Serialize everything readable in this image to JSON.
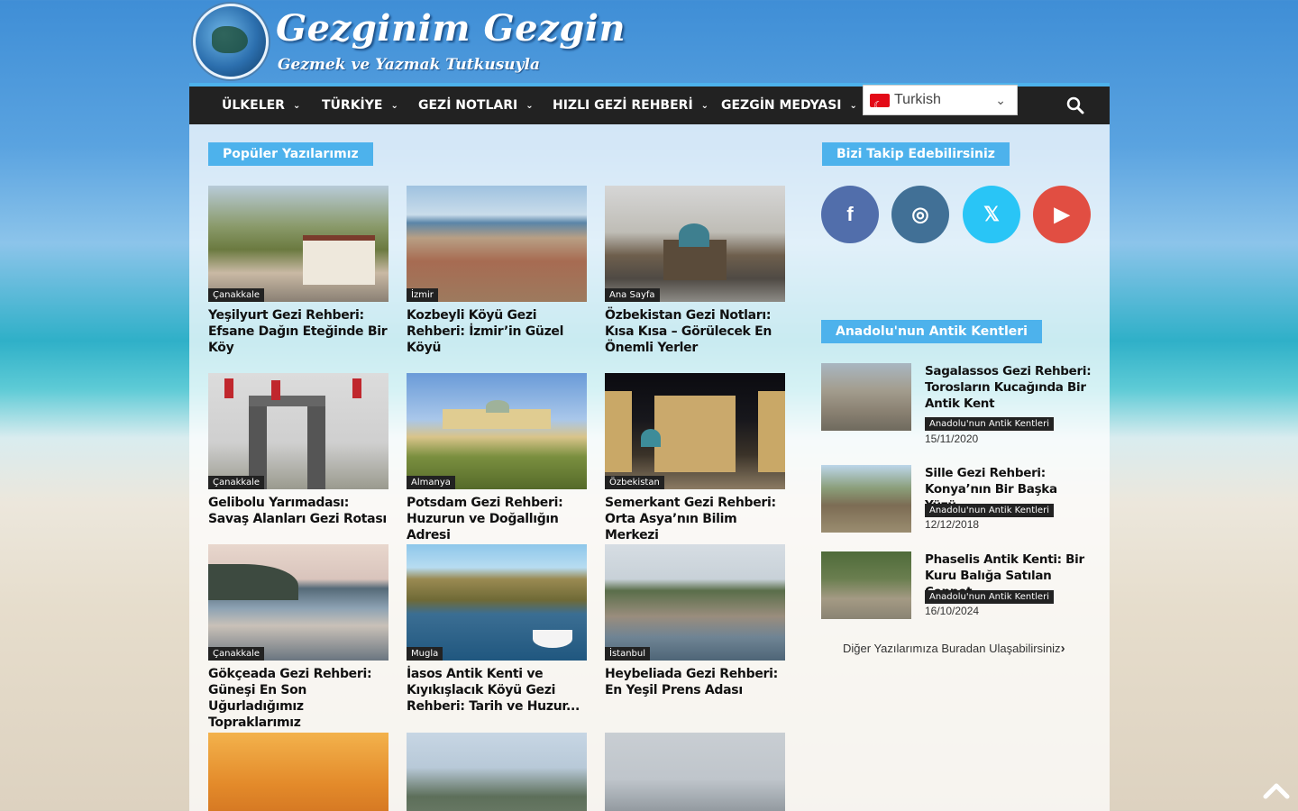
{
  "header": {
    "site_name": "Gezginim Gezgin",
    "tagline": "Gezmek ve Yazmak Tutkusuyla"
  },
  "nav": {
    "items": [
      "ÜLKELER",
      "TÜRKİYE",
      "GEZİ NOTLARI",
      "HIZLI GEZİ REHBERİ",
      "GEZGİN MEDYASI"
    ],
    "language": "Turkish"
  },
  "main": {
    "section_title": "Popüler Yazılarımız",
    "posts": [
      {
        "category": "Çanakkale",
        "title": "Yeşilyurt Gezi Rehberi: Efsane Dağın Eteğinde Bir Köy",
        "thumb": "village-trees"
      },
      {
        "category": "İzmir",
        "title": "Kozbeyli Köyü Gezi Rehberi: İzmir’in Güzel Köyü",
        "thumb": "village-sea"
      },
      {
        "category": "Ana Sayfa",
        "title": "Özbekistan Gezi Notları: Kısa Kısa – Görülecek En Önemli Yerler",
        "thumb": "registan-day"
      },
      {
        "category": "Çanakkale",
        "title": "Gelibolu Yarımadası: Savaş Alanları Gezi Rotası",
        "thumb": "memorial-flags"
      },
      {
        "category": "Almanya",
        "title": "Potsdam Gezi Rehberi: Huzurun ve Doğallığın Adresi",
        "thumb": "palace-garden"
      },
      {
        "category": "Özbekistan",
        "title": "Semerkant Gezi Rehberi: Orta Asya’nın Bilim Merkezi",
        "thumb": "registan-night"
      },
      {
        "category": "Çanakkale",
        "title": "Gökçeada Gezi Rehberi: Güneşi En Son Uğurladığımız Topraklarımız",
        "thumb": "island-sunset"
      },
      {
        "category": "Mugla",
        "title": "İasos Antik Kenti ve Kıyıkışlacık Köyü Gezi Rehberi: Tarih ve Huzur...",
        "thumb": "lake-boat"
      },
      {
        "category": "İstanbul",
        "title": "Heybeliada Gezi Rehberi: En Yeşil Prens Adası",
        "thumb": "island-town"
      },
      {
        "category": "",
        "title": "",
        "thumb": "desert"
      },
      {
        "category": "",
        "title": "",
        "thumb": "coast-hill"
      },
      {
        "category": "",
        "title": "",
        "thumb": "city-view"
      }
    ]
  },
  "sidebar": {
    "follow_title": "Bizi Takip Edebilirsiniz",
    "social": [
      {
        "name": "facebook",
        "glyph": "f",
        "color": "#516eab"
      },
      {
        "name": "instagram",
        "glyph": "◎",
        "color": "#417096"
      },
      {
        "name": "x",
        "glyph": "𝕏",
        "color": "#29c5f6"
      },
      {
        "name": "youtube",
        "glyph": "▶",
        "color": "#e14e42"
      }
    ],
    "ancient_title": "Anadolu'nun Antik Kentleri",
    "ancient_posts": [
      {
        "title": "Sagalassos Gezi Rehberi: Torosların Kucağında Bir Antik Kent",
        "category": "Anadolu'nun Antik Kentleri",
        "date": "15/11/2020"
      },
      {
        "title": "Sille Gezi Rehberi: Konya’nın Bir Başka Yüzü",
        "category": "Anadolu'nun Antik Kentleri",
        "date": "12/12/2018"
      },
      {
        "title": "Phaselis Antik Kenti: Bir Kuru Balığa Satılan Cennet",
        "category": "Anadolu'nun Antik Kentleri",
        "date": "16/10/2024"
      }
    ],
    "more_link": "Diğer Yazılarımıza Buradan Ulaşabilirsiniz"
  },
  "colors": {
    "accent": "#4db2ec",
    "nav_bg": "#222222"
  }
}
